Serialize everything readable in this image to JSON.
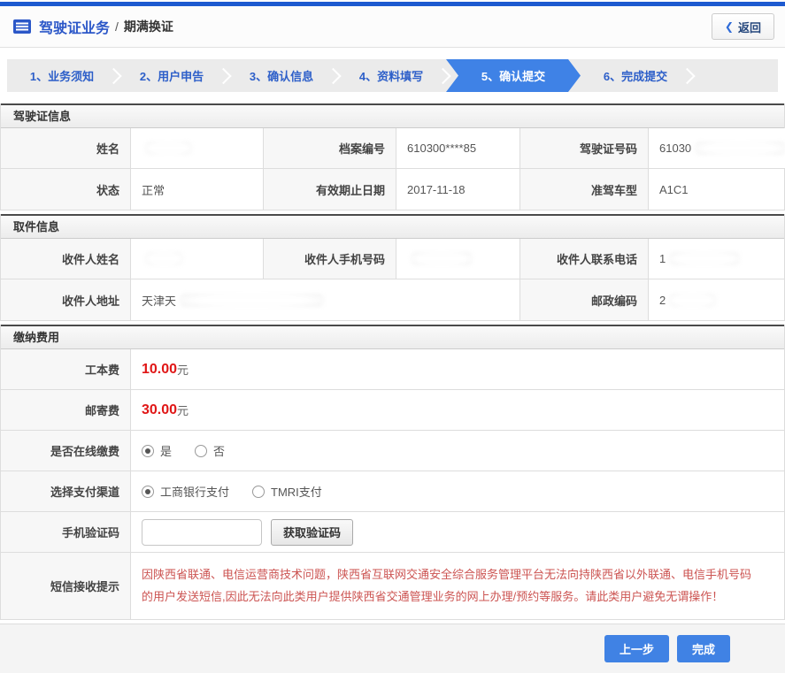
{
  "header": {
    "icon": "document-list-icon",
    "title": "驾驶证业务",
    "separator": "/",
    "subtitle": "期满换证",
    "back_chevron": "❮",
    "back_label": "返回"
  },
  "steps": {
    "active_index": 4,
    "items": [
      {
        "label": "1、业务须知"
      },
      {
        "label": "2、用户申告"
      },
      {
        "label": "3、确认信息"
      },
      {
        "label": "4、资料填写"
      },
      {
        "label": "5、确认提交"
      },
      {
        "label": "6、完成提交"
      }
    ]
  },
  "license": {
    "title": "驾驶证信息",
    "name_label": "姓名",
    "name_value": "",
    "file_no_label": "档案编号",
    "file_no_value": "610300****85",
    "license_no_label": "驾驶证号码",
    "license_no_value": "61030",
    "status_label": "状态",
    "status_value": "正常",
    "expiry_label": "有效期止日期",
    "expiry_value": "2017-11-18",
    "vehicle_class_label": "准驾车型",
    "vehicle_class_value": "A1C1"
  },
  "pickup": {
    "title": "取件信息",
    "recipient_name_label": "收件人姓名",
    "recipient_name_value": "",
    "recipient_mobile_label": "收件人手机号码",
    "recipient_mobile_value": "",
    "recipient_phone_label": "收件人联系电话",
    "recipient_phone_value": "1",
    "recipient_address_label": "收件人地址",
    "recipient_address_value": "天津天",
    "postal_code_label": "邮政编码",
    "postal_code_value": "2"
  },
  "payment": {
    "title": "缴纳费用",
    "production_fee_label": "工本费",
    "production_fee_value": "10.00",
    "postage_fee_label": "邮寄费",
    "postage_fee_value": "30.00",
    "fee_unit": "元",
    "online_payment_label": "是否在线缴费",
    "online_yes": "是",
    "online_no": "否",
    "online_selected": "是",
    "channel_label": "选择支付渠道",
    "channel_icbc": "工商银行支付",
    "channel_tmri": "TMRI支付",
    "channel_selected": "工商银行支付",
    "sms_code_label": "手机验证码",
    "sms_code_value": "",
    "get_code_button": "获取验证码",
    "sms_notice_label": "短信接收提示",
    "sms_notice_text": "因陕西省联通、电信运营商技术问题，陕西省互联网交通安全综合服务管理平台无法向持陕西省以外联通、电信手机号码的用户发送短信,因此无法向此类用户提供陕西省交通管理业务的网上办理/预约等服务。请此类用户避免无谓操作！"
  },
  "footer": {
    "prev_button": "上一步",
    "finish_button": "完成"
  },
  "colors": {
    "accent_blue": "#3f82e6",
    "link_blue": "#2d5fc9",
    "top_bar_blue": "#1d5ad0",
    "price_red": "#e01616",
    "notice_red": "#cc5452"
  }
}
